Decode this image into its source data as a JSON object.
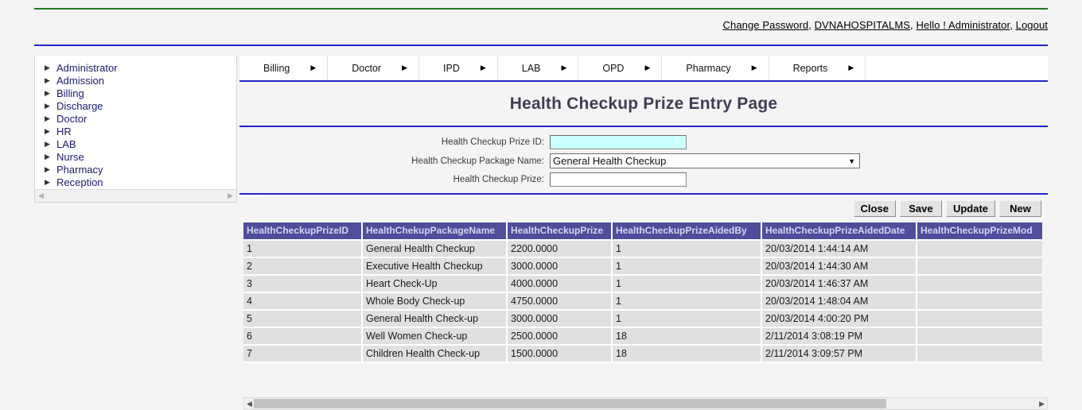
{
  "header": {
    "links": [
      {
        "label": "Change Password",
        "name": "change-password-link"
      },
      {
        "label": "DVNAHOSPITALMS",
        "name": "org-link"
      },
      {
        "label": "Hello ! Administrator",
        "name": "user-greeting-link"
      },
      {
        "label": "Logout",
        "name": "logout-link"
      }
    ],
    "separator": ", ",
    "rule_green": "#1f7a1f",
    "rule_blue": "#2222cc"
  },
  "sidebar": {
    "items": [
      {
        "label": "Administrator"
      },
      {
        "label": "Admission"
      },
      {
        "label": "Billing"
      },
      {
        "label": "Discharge"
      },
      {
        "label": "Doctor"
      },
      {
        "label": "HR"
      },
      {
        "label": "LAB"
      },
      {
        "label": "Nurse"
      },
      {
        "label": "Pharmacy"
      },
      {
        "label": "Reception"
      }
    ],
    "arrow_glyph": "▶",
    "scroll_left_glyph": "◀",
    "scroll_right_glyph": "▶"
  },
  "menubar": {
    "arrow_glyph": "▶",
    "items": [
      {
        "label": "Billing"
      },
      {
        "label": "Doctor"
      },
      {
        "label": "IPD"
      },
      {
        "label": "LAB"
      },
      {
        "label": "OPD"
      },
      {
        "label": "Pharmacy"
      },
      {
        "label": "Reports"
      }
    ]
  },
  "page": {
    "title": "Health Checkup Prize Entry Page"
  },
  "form": {
    "fields": [
      {
        "label": "Health Checkup Prize ID:",
        "type": "text",
        "value": "",
        "placeholder": "",
        "highlight_color": "#ccffff"
      },
      {
        "label": "Health Checkup Package Name:",
        "type": "select",
        "value": "General Health Checkup",
        "caret_glyph": "▼",
        "options": [
          "General Health Checkup"
        ]
      },
      {
        "label": "Health Checkup Prize:",
        "type": "text",
        "value": "",
        "placeholder": ""
      }
    ]
  },
  "buttons": [
    {
      "label": "Close",
      "name": "close-button"
    },
    {
      "label": "Save",
      "name": "save-button"
    },
    {
      "label": "Update",
      "name": "update-button"
    },
    {
      "label": "New",
      "name": "new-button"
    }
  ],
  "grid": {
    "header_bg": "#4e4e9b",
    "header_fg": "#d5d5f0",
    "row_bg": "#e0e0e0",
    "columns": [
      "HealthCheckupPrizeID",
      "HealthChekupPackageName",
      "HealthCheckupPrize",
      "HealthCheckupPrizeAidedBy",
      "HealthCheckupPrizeAidedDate",
      "HealthCheckupPrizeMod"
    ],
    "rows": [
      [
        "1",
        "General Health Checkup",
        "2200.0000",
        "1",
        "20/03/2014 1:44:14 AM",
        ""
      ],
      [
        "2",
        "Executive Health Checkup",
        "3000.0000",
        "1",
        "20/03/2014 1:44:30 AM",
        ""
      ],
      [
        "3",
        "Heart Check-Up",
        "4000.0000",
        "1",
        "20/03/2014 1:46:37 AM",
        ""
      ],
      [
        "4",
        "Whole Body Check-up",
        "4750.0000",
        "1",
        "20/03/2014 1:48:04 AM",
        ""
      ],
      [
        "5",
        "General Health Check-up",
        "3000.0000",
        "1",
        "20/03/2014 4:00:20 PM",
        ""
      ],
      [
        "6",
        "Well Women Check-up",
        "2500.0000",
        "18",
        "2/11/2014 3:08:19 PM",
        ""
      ],
      [
        "7",
        "Children Health Check-up",
        "1500.0000",
        "18",
        "2/11/2014 3:09:57 PM",
        ""
      ]
    ]
  },
  "hscroll": {
    "left_glyph": "◀",
    "right_glyph": "▶"
  }
}
